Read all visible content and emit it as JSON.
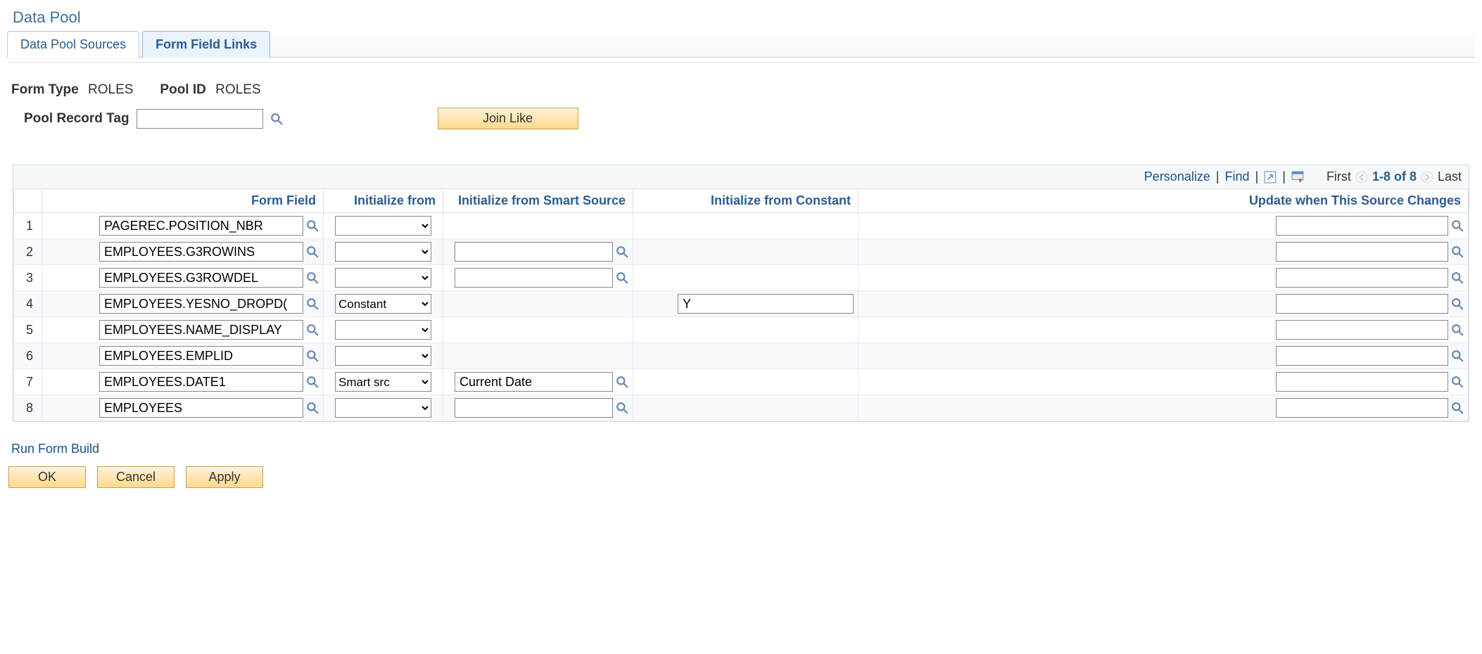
{
  "page": {
    "title": "Data Pool"
  },
  "tabs": [
    {
      "label": "Data Pool Sources",
      "active": false
    },
    {
      "label": "Form Field Links",
      "active": true
    }
  ],
  "meta": {
    "form_type_label": "Form Type",
    "form_type_value": "ROLES",
    "pool_id_label": "Pool ID",
    "pool_id_value": "ROLES",
    "pool_record_tag_label": "Pool Record Tag",
    "pool_record_tag_value": "",
    "join_like_label": "Join Like"
  },
  "grid": {
    "toolbar": {
      "personalize": "Personalize",
      "find": "Find",
      "first": "First",
      "range": "1-8 of 8",
      "last": "Last"
    },
    "headers": {
      "rownum": "",
      "form_field": "Form Field",
      "init_from": "Initialize from",
      "init_smart": "Initialize from Smart Source",
      "init_const": "Initialize from Constant",
      "update_src": "Update when This Source Changes"
    },
    "rows": [
      {
        "n": "1",
        "form_field": "PAGEREC.POSITION_NBR",
        "init_from": "",
        "smart_show": false,
        "smart": "",
        "const_show": false,
        "const": "",
        "update": ""
      },
      {
        "n": "2",
        "form_field": "EMPLOYEES.G3ROWINS",
        "init_from": "",
        "smart_show": true,
        "smart": "",
        "const_show": false,
        "const": "",
        "update": ""
      },
      {
        "n": "3",
        "form_field": "EMPLOYEES.G3ROWDEL",
        "init_from": "",
        "smart_show": true,
        "smart": "",
        "const_show": false,
        "const": "",
        "update": ""
      },
      {
        "n": "4",
        "form_field": "EMPLOYEES.YESNO_DROPD(",
        "init_from": "Constant",
        "smart_show": false,
        "smart": "",
        "const_show": true,
        "const": "Y",
        "update": ""
      },
      {
        "n": "5",
        "form_field": "EMPLOYEES.NAME_DISPLAY",
        "init_from": "",
        "smart_show": false,
        "smart": "",
        "const_show": false,
        "const": "",
        "update": ""
      },
      {
        "n": "6",
        "form_field": "EMPLOYEES.EMPLID",
        "init_from": "",
        "smart_show": false,
        "smart": "",
        "const_show": false,
        "const": "",
        "update": ""
      },
      {
        "n": "7",
        "form_field": "EMPLOYEES.DATE1",
        "init_from": "Smart src",
        "smart_show": true,
        "smart": "Current Date",
        "const_show": false,
        "const": "",
        "update": ""
      },
      {
        "n": "8",
        "form_field": "EMPLOYEES",
        "init_from": "",
        "smart_show": true,
        "smart": "",
        "const_show": false,
        "const": "",
        "update": ""
      }
    ]
  },
  "footer": {
    "run_form_build": "Run Form Build",
    "ok": "OK",
    "cancel": "Cancel",
    "apply": "Apply"
  }
}
